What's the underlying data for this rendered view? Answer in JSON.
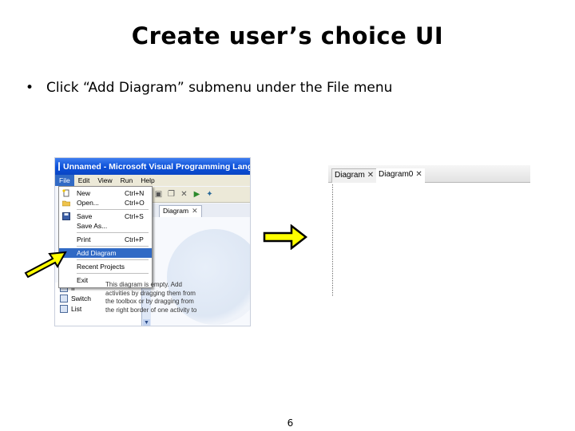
{
  "slide": {
    "title": "Create user’s choice UI",
    "bullet": "•",
    "bullet_text": "Click “Add Diagram” submenu under the File menu",
    "page_number": "6"
  },
  "left_screenshot": {
    "window_title": "Unnamed - Microsoft Visual Programming Langua",
    "menu": [
      "File",
      "Edit",
      "View",
      "Run",
      "Help"
    ],
    "active_menu": "File",
    "tab_label": "Diagram",
    "tab_close": "✕",
    "file_menu": [
      {
        "label": "New",
        "shortcut": "Ctrl+N",
        "icon": "new-file-icon"
      },
      {
        "label": "Open...",
        "shortcut": "Ctrl+O",
        "icon": "open-folder-icon"
      },
      {
        "label": "Save",
        "shortcut": "Ctrl+S",
        "icon": "save-disk-icon"
      },
      {
        "label": "Save As...",
        "shortcut": ""
      },
      {
        "label": "Print",
        "shortcut": "Ctrl+P"
      },
      {
        "label": "Add Diagram",
        "shortcut": "",
        "highlighted": true
      },
      {
        "label": "Recent Projects",
        "shortcut": ""
      },
      {
        "label": "Exit",
        "shortcut": ""
      }
    ],
    "toolbox_items": [
      "If",
      "Switch",
      "List"
    ],
    "empty_message": "This diagram is empty. Add activities by dragging them from the toolbox or by dragging from the right border of one activity to the left border (destination).",
    "highlight_color": "#316ac5",
    "titlebar_color": "#0b4fd8"
  },
  "right_screenshot": {
    "tabs": [
      {
        "label": "Diagram",
        "close": "✕"
      },
      {
        "label": "Diagram0",
        "close": "✕"
      }
    ]
  },
  "arrows": {
    "fill_color": "#ffff00",
    "stroke_color": "#000000"
  }
}
